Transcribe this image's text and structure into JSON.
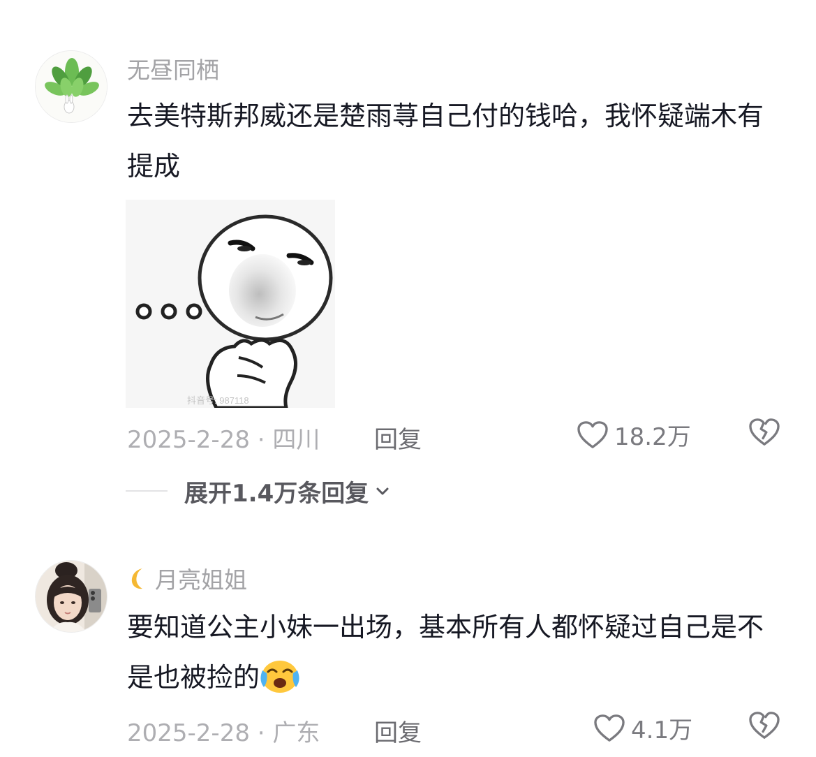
{
  "comments": [
    {
      "username": "无昼同栖",
      "content": "去美特斯邦威还是楚雨荨自己付的钱哈，我怀疑端木有提成",
      "image": "thinking-face-meme",
      "watermark": "抖音号: 987118",
      "date_location": "2025-2-28 · 四川",
      "reply_label": "回复",
      "likes": "18.2万"
    },
    {
      "username_prefix_icon": "crescent-moon",
      "username": "月亮姐姐",
      "content": "要知道公主小妹一出场，基本所有人都怀疑过自己是不是也被捡的",
      "content_emoji": "crying-laughing-emoji",
      "date_location": "2025-2-28 · 广东",
      "reply_label": "回复",
      "likes": "4.1万"
    }
  ],
  "expand_replies": {
    "label": "展开1.4万条回复"
  },
  "colors": {
    "username": "#a3a3a6",
    "text": "#161823",
    "meta": "#aeaeb2",
    "background": "#ffffff"
  }
}
